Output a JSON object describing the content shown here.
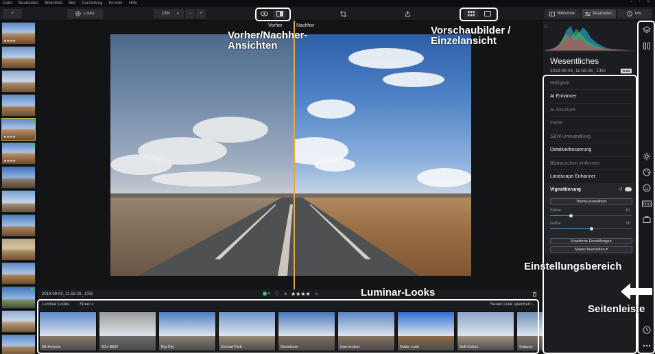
{
  "menu": [
    "Datei",
    "Bearbeiten",
    "Bibliothek",
    "Bild",
    "Darstellung",
    "Fenster",
    "Hilfe"
  ],
  "toolbar": {
    "add_label": "+",
    "looks_label": "Looks",
    "zoom_value": "19%",
    "zoom_minus": "−",
    "zoom_plus": "+",
    "tab_bibliothek": "Bibliothek",
    "tab_bearbeiten": "Bearbeiten",
    "tab_info": "Info"
  },
  "canvas": {
    "vorher_label": "Vorher",
    "nachher_label": "Nachher",
    "filename": "2019-09-03_11-59-26_.CR2",
    "rating_stars": "★★★★",
    "rating_empty": "★",
    "dot_arrow": "▾"
  },
  "looks": {
    "header_label": "Luminar Looks:",
    "category": "Street",
    "save_label": "Neuen Look speichern...",
    "items": [
      {
        "name": "5th Avenue",
        "sky": "#5f8bc9",
        "ground": "#8a7a6a"
      },
      {
        "name": "60's B&W",
        "sky": "#9a9a9a",
        "ground": "#6a6a6a"
      },
      {
        "name": "Big City",
        "sky": "#4c7fc4",
        "ground": "#8a7f72"
      },
      {
        "name": "Central Park",
        "sky": "#6f93c6",
        "ground": "#9a8a74"
      },
      {
        "name": "Downtown",
        "sky": "#4a79bd",
        "ground": "#7c6e60"
      },
      {
        "name": "Intersection",
        "sky": "#5a86c0",
        "ground": "#867360"
      },
      {
        "name": "Noble Look",
        "sky": "#2f6fd2",
        "ground": "#8e6a48"
      },
      {
        "name": "Soft Colors",
        "sky": "#8aa6cc",
        "ground": "#a09080"
      },
      {
        "name": "Subway",
        "sky": "#6f90b8",
        "ground": "#7d7569"
      }
    ]
  },
  "panel": {
    "title": "Wesentliches",
    "filename": "2019-09-03_11-59-26_.CR2",
    "raw_badge": "RAW",
    "tools": [
      {
        "label": "Helligkeit",
        "style": "dim"
      },
      {
        "label": "AI Enhancer",
        "style": "bright"
      },
      {
        "label": "AI Structure",
        "style": "dim"
      },
      {
        "label": "Farbe",
        "style": "dim"
      },
      {
        "label": "S&W-Umwandlung",
        "style": "dim"
      },
      {
        "label": "Detailverbesserung",
        "style": "bright"
      },
      {
        "label": "Bildrauschen entfernen",
        "style": "dim"
      },
      {
        "label": "Landscape Enhancer",
        "style": "bright"
      }
    ],
    "vignette": {
      "title": "Vignettierung",
      "theme_button": "Thema auswählen",
      "strength_label": "Stärke",
      "strength_value": "-51",
      "strength_fraction": 0.25,
      "size_label": "Größe",
      "size_value": "50",
      "size_fraction": 0.5,
      "advanced_button": "Erweiterte Einstellungen",
      "mask_button": "Maske bearbeiten ▾"
    }
  },
  "annotations": {
    "before_after": "Vorher/Nachher-\nAnsichten",
    "thumbnails": "Vorschaubilder /\nEinzelansicht",
    "luminar_looks": "Luminar-Looks",
    "settings": "Einstellungsbereich",
    "sidebar": "Seitenleiste"
  },
  "filmstrip": {
    "star_label": "★★★★"
  }
}
